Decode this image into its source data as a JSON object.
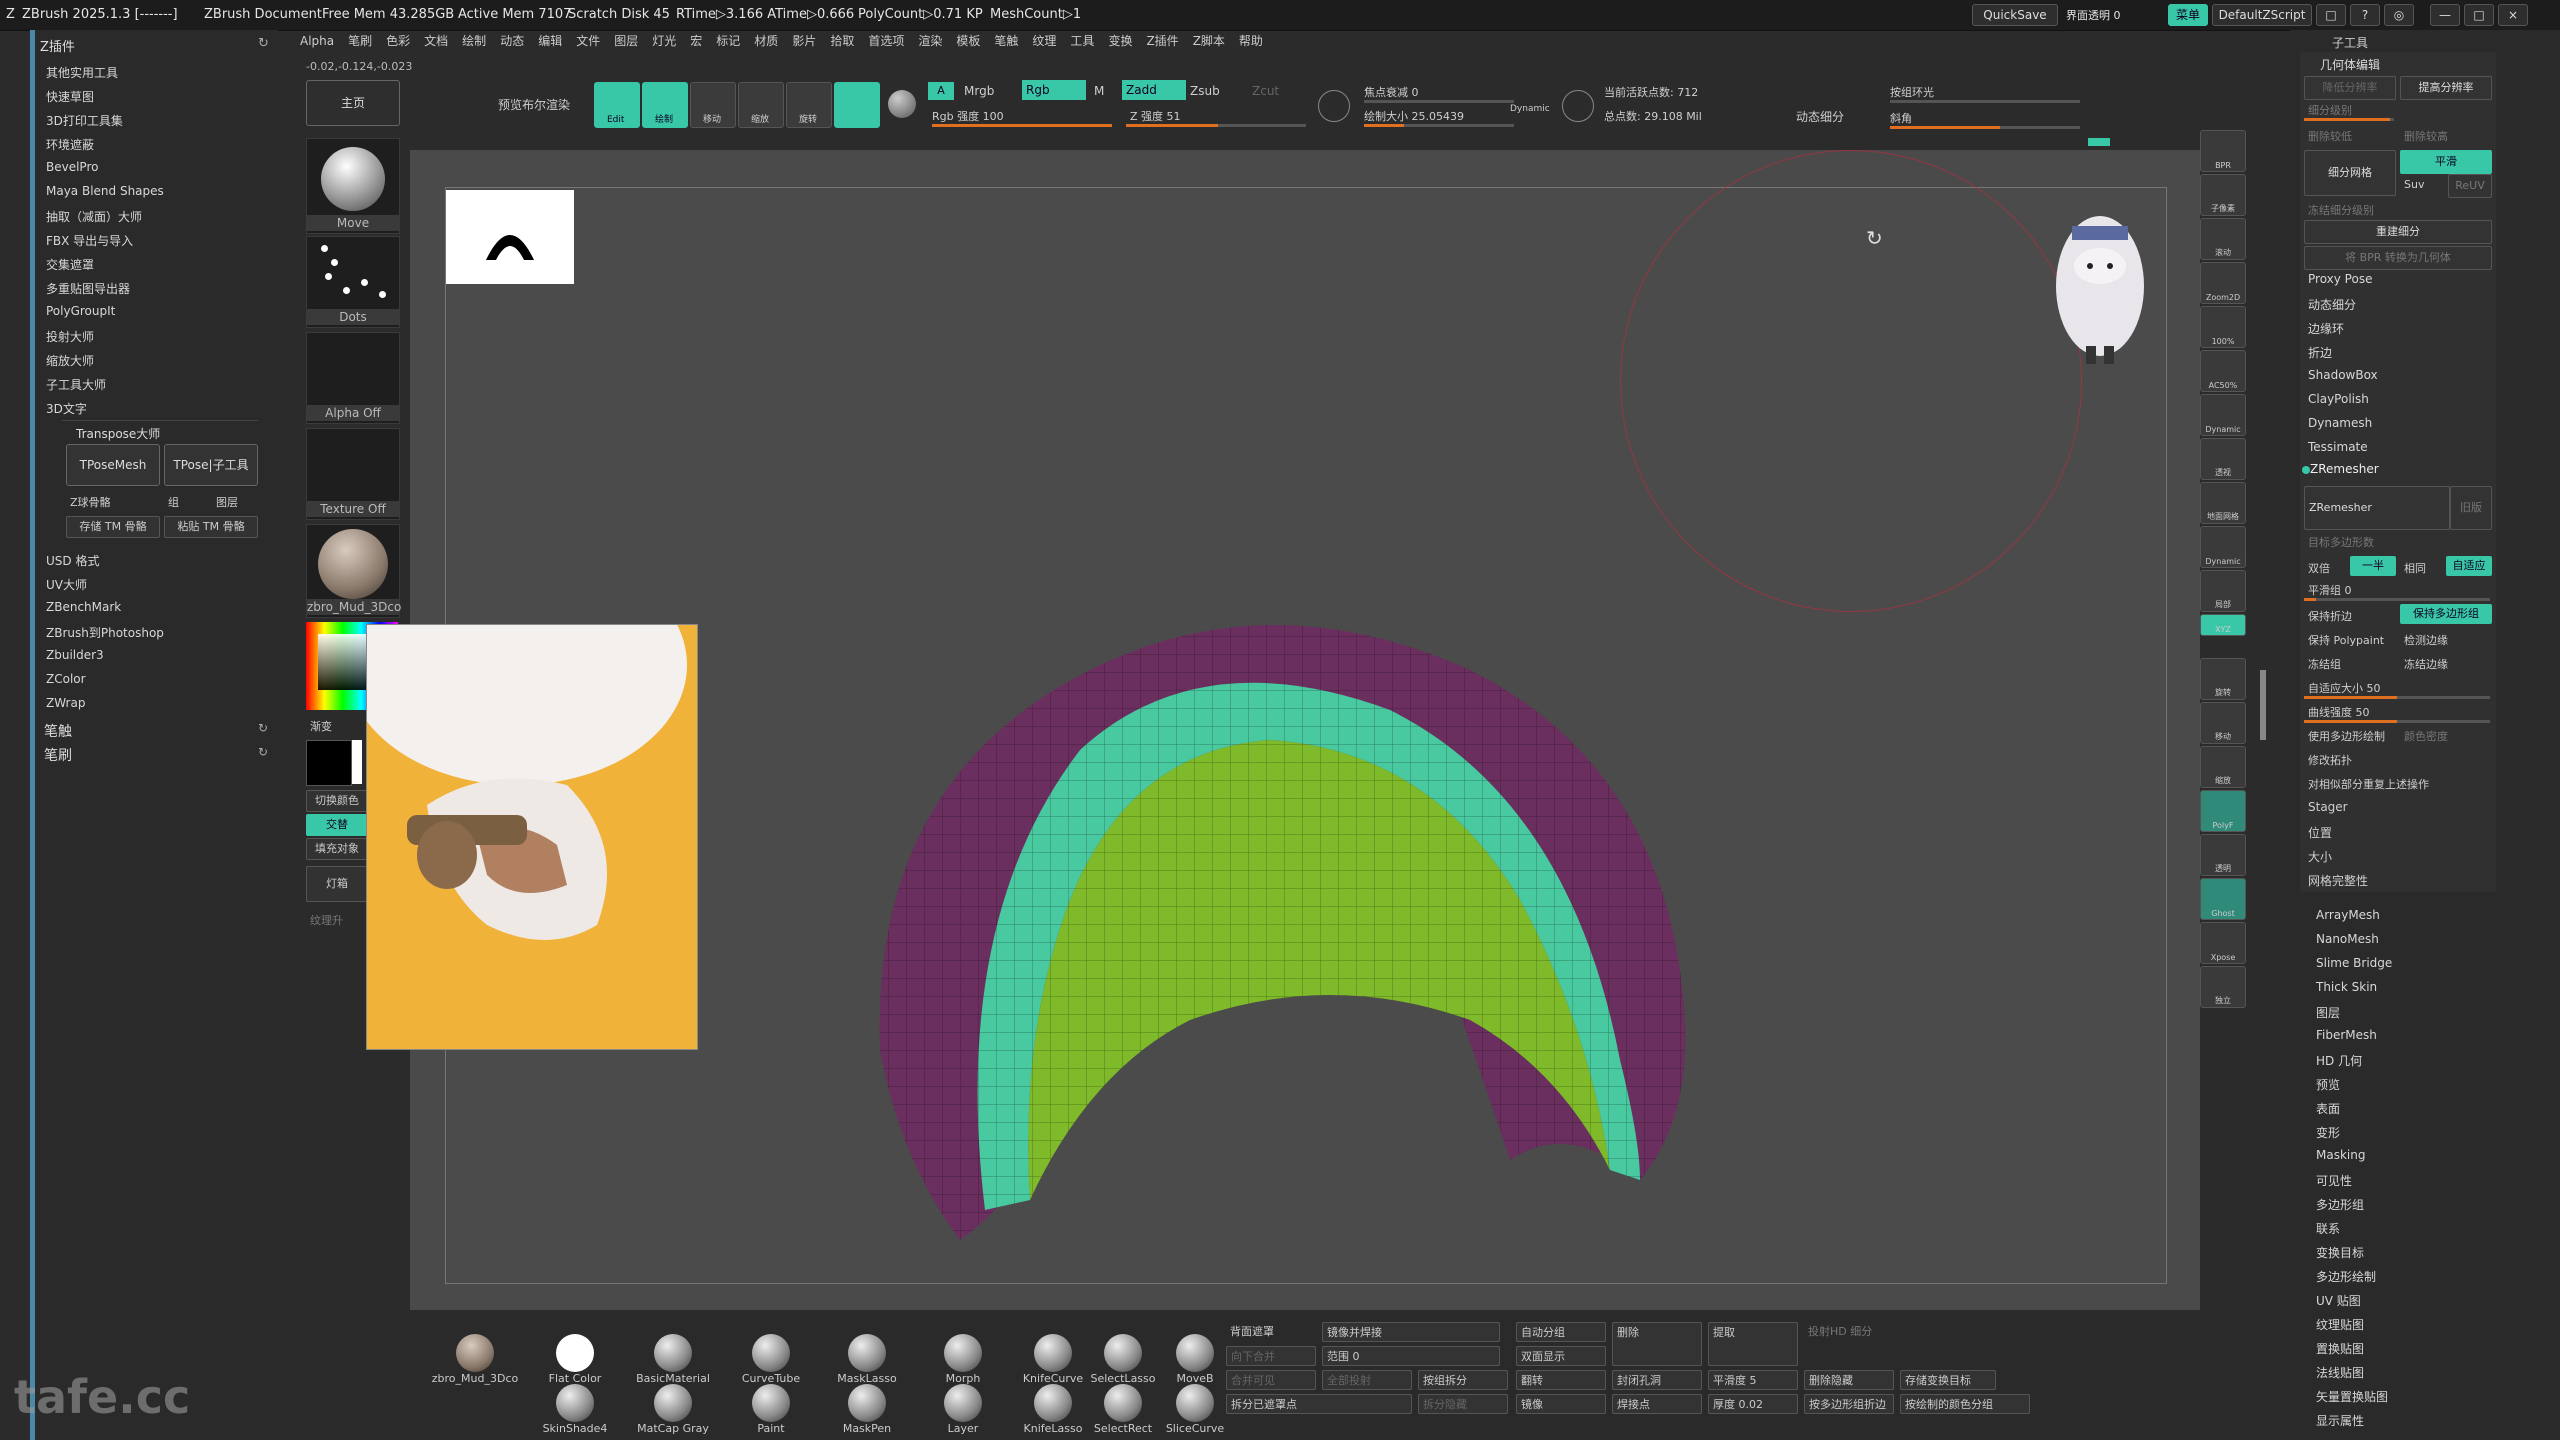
{
  "titlebar": {
    "app": "ZBrush 2025.1.3 [-------]",
    "document": "ZBrush Document",
    "free_mem": "Free Mem 43.285GB",
    "active_mem": "Active Mem 7107",
    "scratch": "Scratch Disk 45",
    "rtime": "RTime▷3.166 ATime▷0.666",
    "polycount": "PolyCount▷0.71 KP",
    "meshcount": "MeshCount▷1",
    "quicksave": "QuickSave",
    "ui_opacity": "界面透明 0",
    "menus_btn": "菜单",
    "default_zscript": "DefaultZScript"
  },
  "coords": "-0.02,-0.124,-0.023",
  "menubar": [
    "Alpha",
    "笔刷",
    "色彩",
    "文档",
    "绘制",
    "动态",
    "编辑",
    "文件",
    "图层",
    "灯光",
    "宏",
    "标记",
    "材质",
    "影片",
    "拾取",
    "首选项",
    "渲染",
    "模板",
    "笔触",
    "纹理",
    "工具",
    "变换",
    "Z插件",
    "Z脚本",
    "帮助"
  ],
  "left": {
    "header": "Z插件",
    "items": [
      "其他实用工具",
      "快速草图",
      "3D打印工具集",
      "环境遮蔽",
      "BevelPro",
      "Maya Blend Shapes",
      "抽取（减面）大师",
      "FBX 导出与导入",
      "交集遮罩",
      "多重贴图导出器",
      "PolyGroupIt",
      "投射大师",
      "缩放大师",
      "子工具大师",
      "3D文字"
    ],
    "transpose_header": "Transpose大师",
    "tposemesh": "TPoseMesh",
    "tpose_sub": "TPose|子工具",
    "z_sphere": "Z球骨骼",
    "group": "组",
    "layer": "图层",
    "store_tm": "存储 TM 骨骼",
    "paste_tm": "粘贴 TM 骨骼",
    "items2": [
      "USD 格式",
      "UV大师",
      "ZBenchMark",
      "ZBrush到Photoshop",
      "Zbuilder3",
      "ZColor",
      "ZWrap"
    ],
    "brush_touch": "笔触",
    "brush": "笔刷"
  },
  "sidecol": {
    "home": "主页",
    "move": "Move",
    "dots": "Dots",
    "alpha_off": "Alpha Off",
    "texture_off": "Texture Off",
    "material": "zbro_Mud_3Dco",
    "gradient": "渐变",
    "switch_color": "切换颜色",
    "alternate": "交替",
    "fill_object": "填充对象",
    "light_box": "灯箱",
    "texture_lift": "纹理升"
  },
  "toolbar": {
    "preview_render": "预览布尔渲染",
    "edit": "Edit",
    "draw": "绘制",
    "move": "移动",
    "scale": "缩放",
    "rotate": "旋转",
    "a": "A",
    "mrgb": "Mrgb",
    "rgb": "Rgb",
    "m": "M",
    "rgb_intensity": "Rgb 强度 100",
    "zadd": "Zadd",
    "zsub": "Zsub",
    "zcut": "Zcut",
    "z_intensity": "Z 强度 51",
    "focal_shift": "焦点衰减 0",
    "draw_size": "绘制大小 25.05439",
    "dynamic": "Dynamic",
    "active_points": "当前活跃点数: 712",
    "total_points": "总点数: 29.108 Mil",
    "dyn_subdiv": "动态细分",
    "edge_loop": "按组环光",
    "bevel": "斜角",
    "rgb_pct": 1.0,
    "z_pct": 0.51
  },
  "shelf": [
    "BPR",
    "子像素",
    "滚动",
    "Zoom2D",
    "100%",
    "AC50%",
    "Dynamic",
    "透视",
    "地面网格",
    "Dynamic",
    "局部",
    "XYZ",
    "旋转",
    "移动",
    "缩放",
    "PolyF",
    "透明",
    "Ghost",
    "Xpose",
    "独立"
  ],
  "right": {
    "subtool": "子工具",
    "geometry": "几何体编辑",
    "lower_res": "降低分辨率",
    "higher_res": "提高分辨率",
    "subdiv_level": "细分级别",
    "delete_lower": "删除较低",
    "delete_higher": "删除较高",
    "divide": "细分网格",
    "smooth": "平滑",
    "suv": "Suv",
    "reuv": "ReUV",
    "freeze_subdiv": "冻结细分级别",
    "reconstruct": "重建细分",
    "convert_bpr": "将 BPR 转换为几何体",
    "items": [
      "Proxy Pose",
      "动态细分",
      "边缘环",
      "折边",
      "ShadowBox",
      "ClayPolish",
      "Dynamesh",
      "Tessimate"
    ],
    "zremesher_header": "ZRemesher",
    "zremesher_btn": "ZRemesher",
    "legacy": "旧版",
    "target_poly": "目标多边形数",
    "half": "一半",
    "double": "双倍",
    "same": "相同",
    "adaptive": "自适应",
    "smooth_group": "平滑组 0",
    "keep_creases": "保持折边",
    "keep_polygroups": "保持多边形组",
    "keep_polypaint": "保持 Polypaint",
    "detect_edges": "检测边缘",
    "freeze_groups": "冻结组",
    "freeze_border": "冻结边缘",
    "adaptive_size": "自适应大小 50",
    "curve_strength": "曲线强度 50",
    "use_polypaint": "使用多边形绘制",
    "color_density": "颜色密度",
    "modify_topo": "修改拓扑",
    "repeat_similar": "对相似部分重复上述操作",
    "stager": "Stager",
    "position": "位置",
    "size": "大小",
    "mesh_integrity": "网格完整性",
    "items2": [
      "ArrayMesh",
      "NanoMesh",
      "Slime Bridge",
      "Thick Skin",
      "图层",
      "FiberMesh",
      "HD 几何",
      "预览",
      "表面",
      "变形",
      "Masking",
      "可见性",
      "多边形组",
      "联系",
      "变换目标",
      "多边形绘制",
      "UV 贴图",
      "纹理贴图",
      "置换贴图",
      "法线贴图",
      "矢量置换贴图",
      "显示属性"
    ]
  },
  "bottom": {
    "brushes": [
      "zbro_Mud_3Dco",
      "Flat Color",
      "BasicMaterial",
      "CurveTube",
      "MaskLasso",
      "Morph",
      "KnifeCurve",
      "SelectLasso",
      "MoveB",
      "SkinShade4",
      "MatCap Gray",
      "Paint",
      "MaskPen",
      "Layer",
      "KnifeLasso",
      "SelectRect",
      "SliceCurve"
    ],
    "backface_mask": "背面遮罩",
    "mirror_weld": "镜像并焊接",
    "auto_group": "自动分组",
    "delete": "删除",
    "extract": "提取",
    "merge_down": "向下合并",
    "range": "范围 0",
    "double_sided": "双面显示",
    "merge_visible": "合并可见",
    "project_all": "全部投射",
    "group_split": "按组拆分",
    "flip": "翻转",
    "close_holes": "封闭孔洞",
    "smooth5": "平滑度 5",
    "delete_hidden": "删除隐藏",
    "store_morph": "存储变换目标",
    "split_masked": "拆分已遮罩点",
    "split_hidden": "拆分隐藏",
    "mirror": "镜像",
    "weld_points": "焊接点",
    "thickness": "厚度 0.02",
    "polygroup_crease": "按多边形组折边",
    "polypaint_group": "按绘制的颜色分组",
    "project_hd": "投射HD 细分"
  },
  "watermark": "tafe.cc",
  "colors": {
    "accent": "#38c8a8",
    "slider": "#e07020",
    "mesh_inner": "#7fba2a",
    "mesh_rim": "#49c9a0",
    "mesh_outer": "#6a2f5e"
  }
}
